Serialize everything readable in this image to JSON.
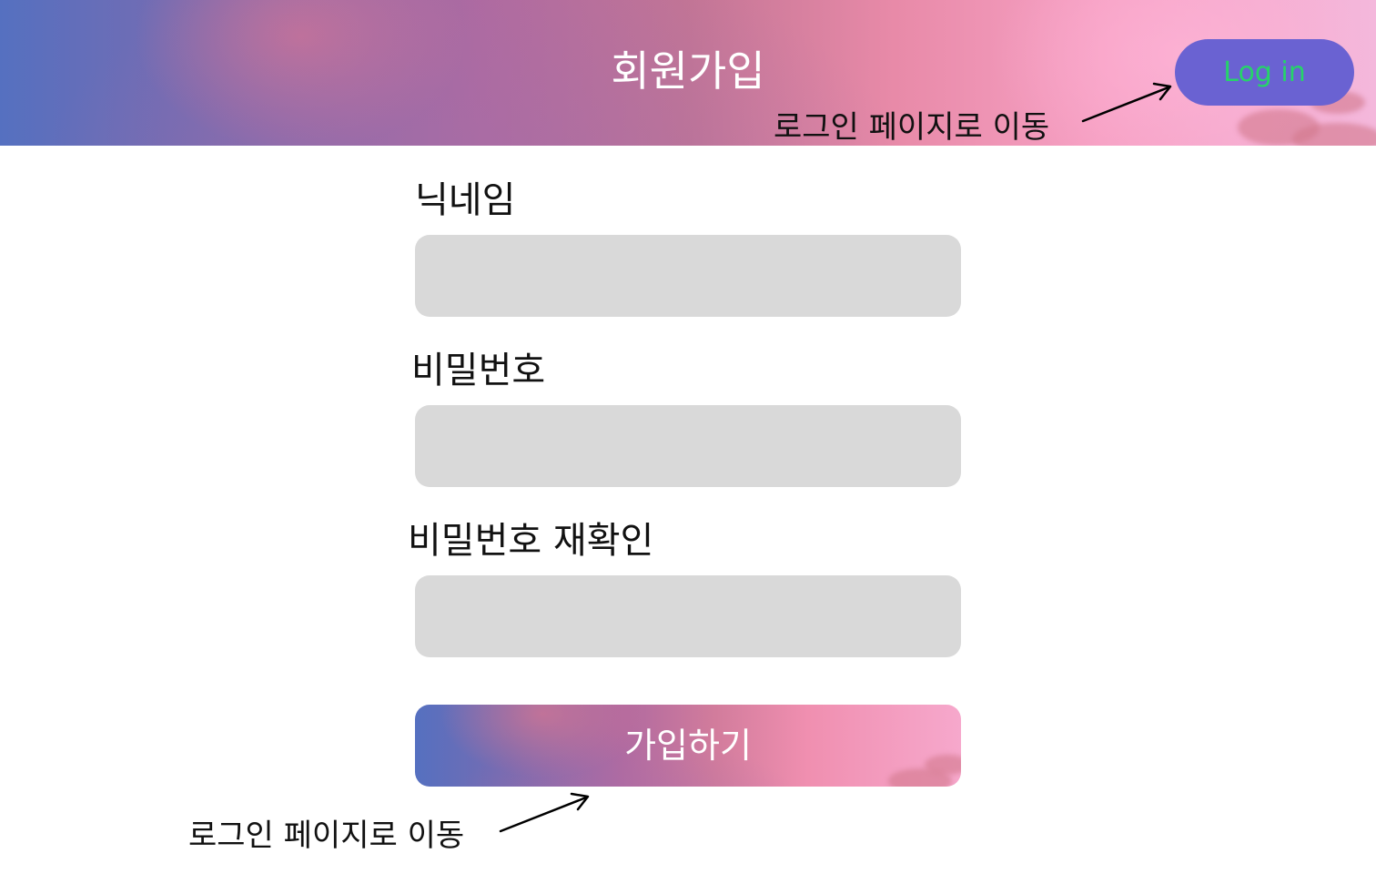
{
  "header": {
    "title": "회원가입",
    "login_button": "Log in",
    "login_annotation": "로그인 페이지로 이동"
  },
  "form": {
    "nickname_label": "닉네임",
    "password_label": "비밀번호",
    "password_confirm_label": "비밀번호 재확인",
    "nickname_value": "",
    "password_value": "",
    "password_confirm_value": "",
    "submit_label": "가입하기",
    "submit_annotation": "로그인 페이지로 이동"
  },
  "colors": {
    "login_button_bg": "#6a62d2",
    "login_button_text": "#26d36a",
    "input_bg": "#d9d9d9"
  }
}
